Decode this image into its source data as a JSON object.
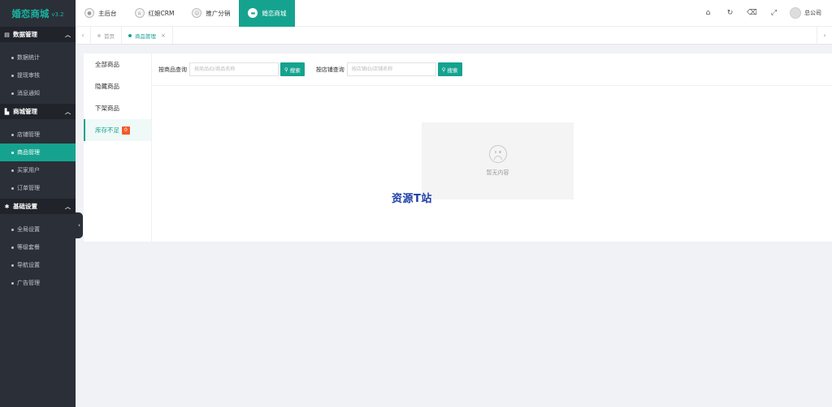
{
  "sidebar": {
    "logo": {
      "name": "婚恋商城",
      "version": "v3.2"
    },
    "groups": [
      {
        "title": "数据管理",
        "items": [
          "数据统计",
          "提现审核",
          "消息通知"
        ]
      },
      {
        "title": "商城管理",
        "items": [
          "店铺管理",
          "商品管理",
          "买家用户",
          "订单管理"
        ]
      },
      {
        "title": "基础设置",
        "items": [
          "全局设置",
          "等级套餐",
          "导航设置",
          "广告管理"
        ]
      }
    ],
    "active_item": "商品管理"
  },
  "header": {
    "nav": [
      {
        "label": "主后台",
        "icon": "user-icon"
      },
      {
        "label": "红娘CRM",
        "icon": "home-icon"
      },
      {
        "label": "推广分销",
        "icon": "smile-icon"
      },
      {
        "label": "婚恋商城",
        "icon": "shop-icon"
      }
    ],
    "active_nav": "婚恋商城",
    "tools": [
      "home-icon",
      "refresh-icon",
      "clear-icon",
      "fullscreen-icon"
    ],
    "user_name": "总公司"
  },
  "tabs": [
    {
      "label": "首页",
      "closable": false
    },
    {
      "label": "商品管理",
      "closable": true
    }
  ],
  "main": {
    "vtabs": [
      {
        "label": "全部商品"
      },
      {
        "label": "隐藏商品"
      },
      {
        "label": "下架商品"
      },
      {
        "label": "库存不足",
        "badge": "0"
      }
    ],
    "active_vtab": "库存不足",
    "filters": [
      {
        "label": "按商品查询",
        "placeholder": "按商品ID/商品名称",
        "button": "搜索"
      },
      {
        "label": "按店铺查询",
        "placeholder": "按店铺ID/店铺名称",
        "button": "搜索"
      }
    ],
    "empty_text": "暂无内容",
    "watermark": "资源T站"
  },
  "colors": {
    "accent": "#15a38f",
    "sidebar_bg": "#2b2f38",
    "badge": "#f25a29"
  }
}
